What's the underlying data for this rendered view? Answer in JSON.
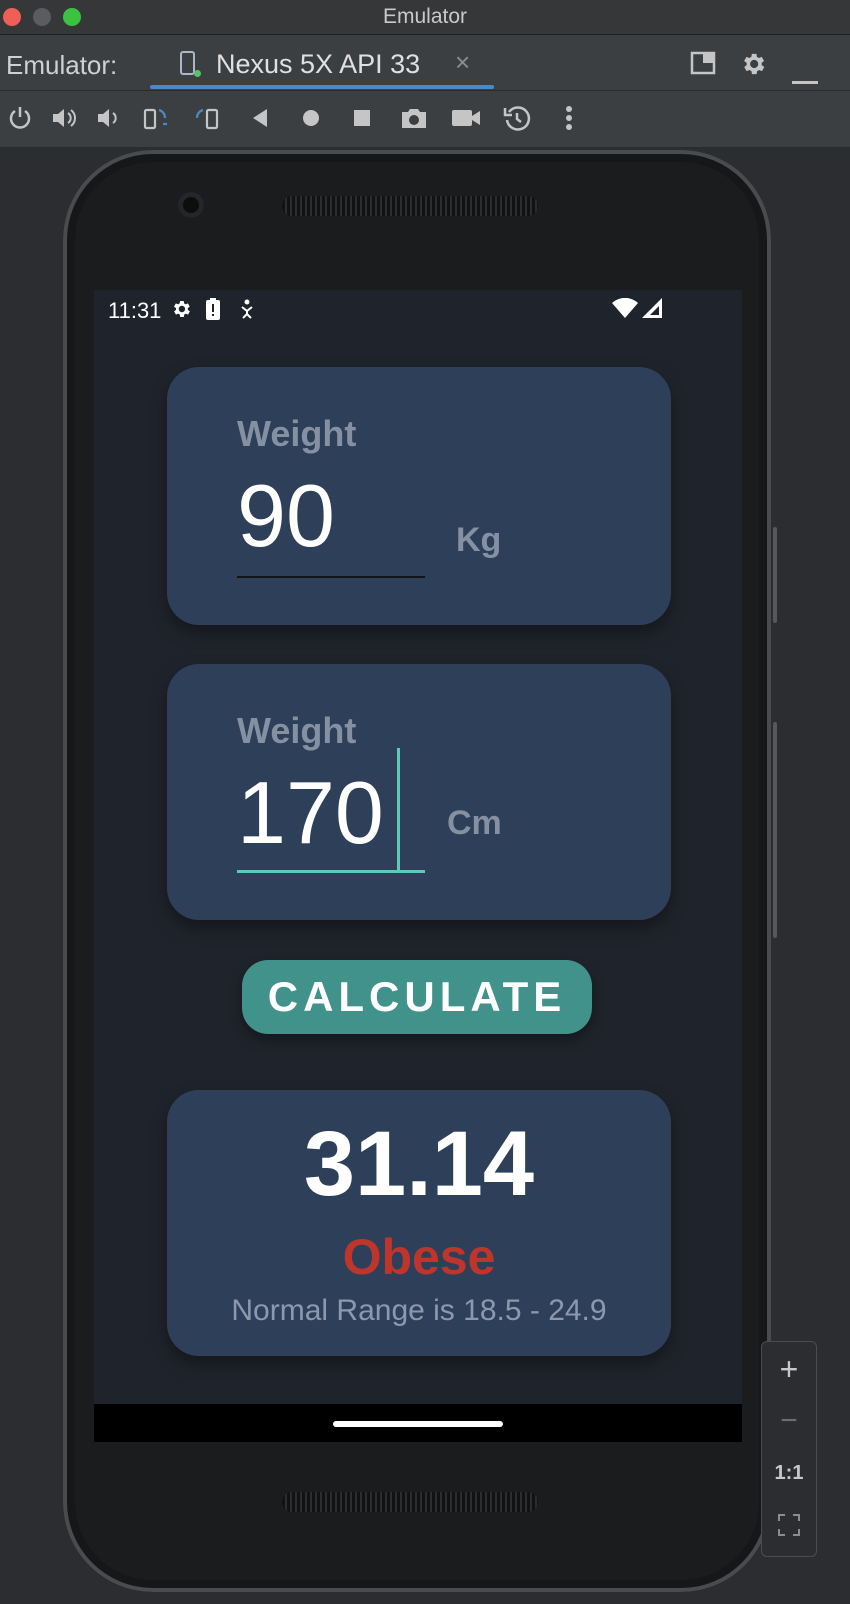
{
  "window": {
    "title": "Emulator"
  },
  "tabbar": {
    "label": "Emulator:",
    "device_tab": {
      "label": "Nexus 5X API 33",
      "close": "×"
    },
    "right_icons": [
      "window-mode-icon",
      "settings-icon",
      "minimize-icon"
    ]
  },
  "toolbar": {
    "tools": [
      "power-icon",
      "volume-up-icon",
      "volume-down-icon",
      "rotate-left-icon",
      "rotate-right-icon",
      "back-icon",
      "home-icon",
      "overview-icon",
      "screenshot-icon",
      "screen-record-icon",
      "snapshot-icon",
      "more-icon"
    ]
  },
  "statusbar": {
    "time": "11:31",
    "icons": [
      "settings-icon",
      "battery-alert-icon",
      "accessibility-icon",
      "wifi-icon",
      "signal-icon"
    ]
  },
  "app": {
    "weight_card": {
      "label": "Weight",
      "value": "90",
      "unit": "Kg"
    },
    "height_card": {
      "label": "Weight",
      "value": "170",
      "unit": "Cm"
    },
    "calculate_label": "CALCULATE",
    "result": {
      "value": "31.14",
      "category": "Obese",
      "range_text": "Normal Range is 18.5 - 24.9"
    }
  },
  "zoom": {
    "zoom_in": "+",
    "zoom_out": "−",
    "one_to_one": "1:1"
  },
  "colors": {
    "background": "#1f232b",
    "card": "#2e4059",
    "accent": "#41928a",
    "danger": "#c0352b",
    "muted_text": "#8590a3"
  }
}
